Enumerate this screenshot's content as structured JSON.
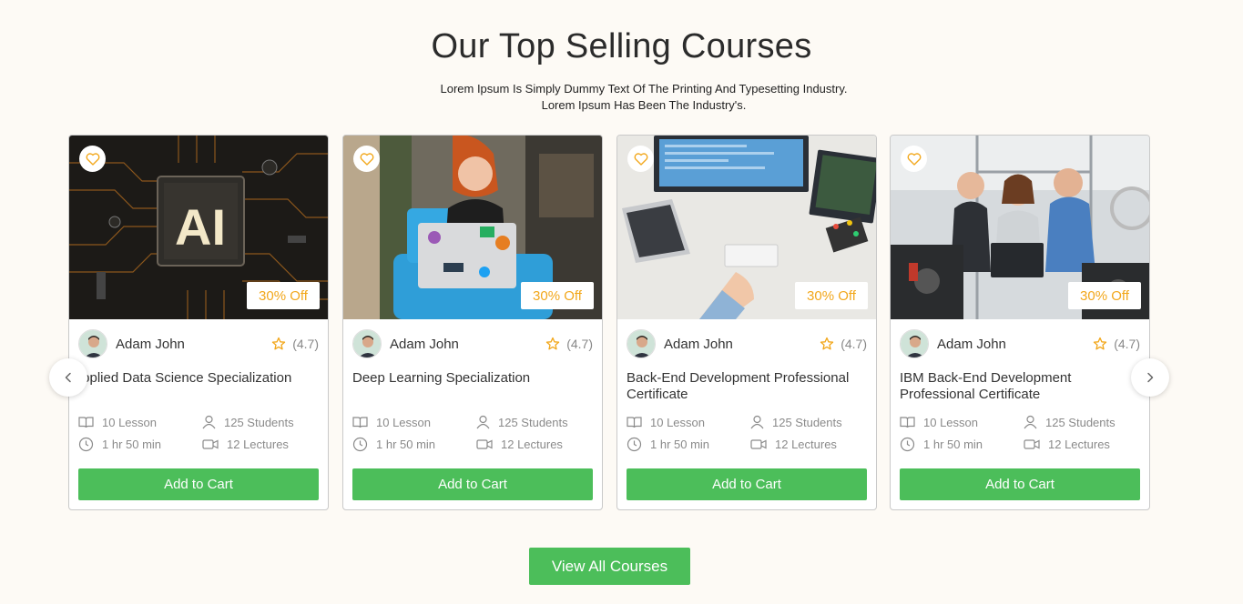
{
  "section": {
    "title": "Our Top Selling Courses",
    "subtitle": "Lorem Ipsum Is Simply Dummy Text Of The Printing And Typesetting Industry. Lorem Ipsum Has Been The Industry's."
  },
  "courses": [
    {
      "image": "ai-chip-image",
      "image_text": "AI",
      "discount": "30% Off",
      "author": "Adam John",
      "rating": "(4.7)",
      "title": ".pplied Data Science Specialization",
      "lessons": "10 Lesson",
      "students": "125 Students",
      "duration": "1 hr 50 min",
      "lectures": "12 Lectures",
      "cta": "Add to Cart"
    },
    {
      "image": "woman-laptop-image",
      "discount": "30% Off",
      "author": "Adam John",
      "rating": "(4.7)",
      "title": "Deep Learning Specialization",
      "lessons": "10 Lesson",
      "students": "125 Students",
      "duration": "1 hr 50 min",
      "lectures": "12 Lectures",
      "cta": "Add to Cart"
    },
    {
      "image": "developer-desk-image",
      "discount": "30% Off",
      "author": "Adam John",
      "rating": "(4.7)",
      "title": "Back-End Development Professional Certificate",
      "lessons": "10 Lesson",
      "students": "125 Students",
      "duration": "1 hr 50 min",
      "lectures": "12 Lectures",
      "cta": "Add to Cart"
    },
    {
      "image": "engineers-lab-image",
      "discount": "30% Off",
      "author": "Adam John",
      "rating": "(4.7)",
      "title": "IBM Back-End Development Professional Certificate",
      "lessons": "10 Lesson",
      "students": "125 Students",
      "duration": "1 hr 50 min",
      "lectures": "12 Lectures",
      "cta": "Add to Cart"
    }
  ],
  "carousel": {
    "prev_icon": "chevron-left-icon",
    "next_icon": "chevron-right-icon"
  },
  "view_all": "View All Courses",
  "colors": {
    "accent": "#4cbe5a",
    "discount": "#f2a71b",
    "star": "#f2a71b",
    "background": "#fdfaf5"
  }
}
